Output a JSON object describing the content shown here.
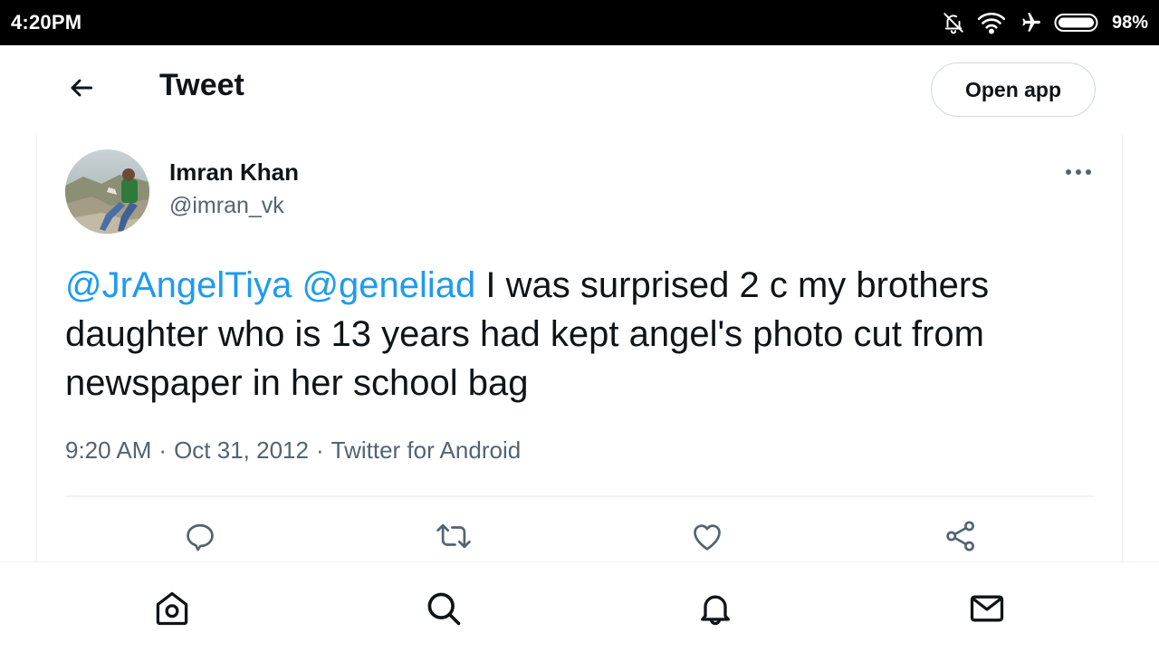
{
  "status_bar": {
    "time": "4:20PM",
    "battery_percent": "98%",
    "icons": [
      "bell-muted-icon",
      "wifi-icon",
      "airplane-icon",
      "battery-icon"
    ]
  },
  "header": {
    "title": "Tweet",
    "open_app_label": "Open app",
    "back_icon": "arrow-left-icon"
  },
  "tweet": {
    "author_name": "Imran Khan",
    "author_handle": "@imran_vk",
    "mention_1": "@JrAngelTiya",
    "mention_2": "@geneliad",
    "body": " I was surprised 2 c my brothers daughter who is 13 years had kept angel's photo cut from newspaper in her school bag",
    "time": "9:20 AM",
    "date": "Oct 31, 2012",
    "source": "Twitter for Android",
    "separator": "·"
  },
  "actions": [
    "reply-icon",
    "retweet-icon",
    "like-icon",
    "share-icon"
  ],
  "bottom_nav": [
    "home-icon",
    "search-icon",
    "notifications-icon",
    "messages-icon"
  ],
  "colors": {
    "accent": "#1d9bf0",
    "text_primary": "#0f1419",
    "text_secondary": "#536471",
    "border": "#eff3f4"
  }
}
